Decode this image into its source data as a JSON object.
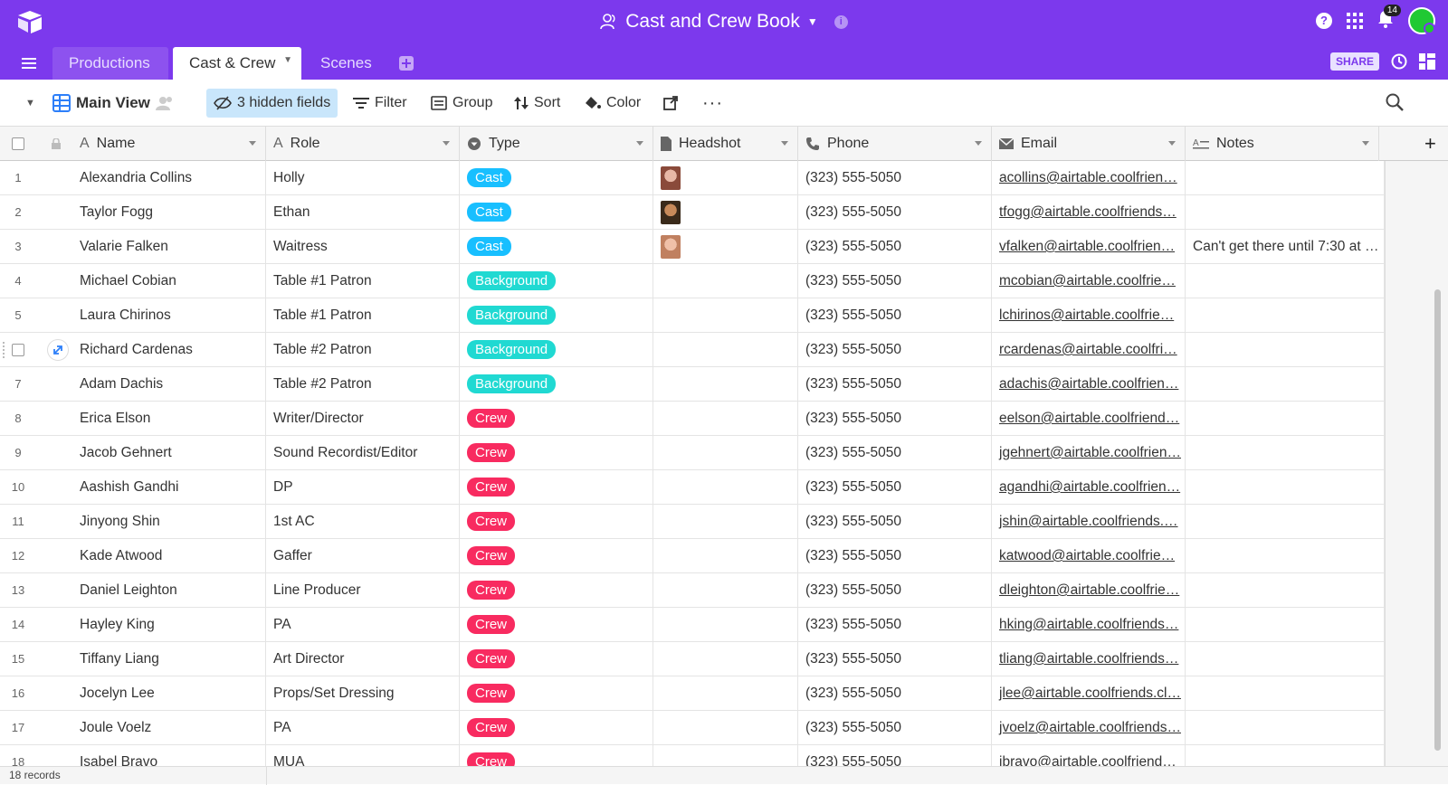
{
  "header": {
    "base_title": "Cast and Crew Book",
    "notification_count": "14",
    "share_label": "SHARE"
  },
  "tabs": [
    {
      "label": "Productions"
    },
    {
      "label": "Cast & Crew"
    },
    {
      "label": "Scenes"
    }
  ],
  "viewbar": {
    "view_name": "Main View",
    "hidden_fields": "3 hidden fields",
    "filter": "Filter",
    "group": "Group",
    "sort": "Sort",
    "color": "Color"
  },
  "columns": [
    "Name",
    "Role",
    "Type",
    "Headshot",
    "Phone",
    "Email",
    "Notes"
  ],
  "rows": [
    {
      "num": "1",
      "name": "Alexandria Collins",
      "role": "Holly",
      "type": "Cast",
      "headshot": true,
      "phone": "(323) 555-5050",
      "email": "acollins@airtable.coolfrien…",
      "notes": ""
    },
    {
      "num": "2",
      "name": "Taylor Fogg",
      "role": "Ethan",
      "type": "Cast",
      "headshot": true,
      "phone": "(323) 555-5050",
      "email": "tfogg@airtable.coolfriends…",
      "notes": ""
    },
    {
      "num": "3",
      "name": "Valarie Falken",
      "role": "Waitress",
      "type": "Cast",
      "headshot": true,
      "phone": "(323) 555-5050",
      "email": "vfalken@airtable.coolfrien…",
      "notes": "Can't get there until 7:30 at …"
    },
    {
      "num": "4",
      "name": "Michael Cobian",
      "role": "Table #1 Patron",
      "type": "Background",
      "headshot": false,
      "phone": "(323) 555-5050",
      "email": "mcobian@airtable.coolfrie…",
      "notes": ""
    },
    {
      "num": "5",
      "name": "Laura Chirinos",
      "role": "Table #1 Patron",
      "type": "Background",
      "headshot": false,
      "phone": "(323) 555-5050",
      "email": "lchirinos@airtable.coolfrie…",
      "notes": ""
    },
    {
      "num": "",
      "name": "Richard Cardenas",
      "role": "Table #2 Patron",
      "type": "Background",
      "headshot": false,
      "phone": "(323) 555-5050",
      "email": "rcardenas@airtable.coolfri…",
      "notes": ""
    },
    {
      "num": "7",
      "name": "Adam Dachis",
      "role": "Table #2 Patron",
      "type": "Background",
      "headshot": false,
      "phone": "(323) 555-5050",
      "email": "adachis@airtable.coolfrien…",
      "notes": ""
    },
    {
      "num": "8",
      "name": "Erica Elson",
      "role": "Writer/Director",
      "type": "Crew",
      "headshot": false,
      "phone": "(323) 555-5050",
      "email": "eelson@airtable.coolfriend…",
      "notes": ""
    },
    {
      "num": "9",
      "name": "Jacob Gehnert",
      "role": "Sound Recordist/Editor",
      "type": "Crew",
      "headshot": false,
      "phone": "(323) 555-5050",
      "email": "jgehnert@airtable.coolfrien…",
      "notes": ""
    },
    {
      "num": "10",
      "name": "Aashish Gandhi",
      "role": "DP",
      "type": "Crew",
      "headshot": false,
      "phone": "(323) 555-5050",
      "email": "agandhi@airtable.coolfrien…",
      "notes": ""
    },
    {
      "num": "11",
      "name": "Jinyong Shin",
      "role": "1st AC",
      "type": "Crew",
      "headshot": false,
      "phone": "(323) 555-5050",
      "email": "jshin@airtable.coolfriends.…",
      "notes": ""
    },
    {
      "num": "12",
      "name": "Kade Atwood",
      "role": "Gaffer",
      "type": "Crew",
      "headshot": false,
      "phone": "(323) 555-5050",
      "email": "katwood@airtable.coolfrie…",
      "notes": ""
    },
    {
      "num": "13",
      "name": "Daniel Leighton",
      "role": "Line Producer",
      "type": "Crew",
      "headshot": false,
      "phone": "(323) 555-5050",
      "email": "dleighton@airtable.coolfrie…",
      "notes": ""
    },
    {
      "num": "14",
      "name": "Hayley King",
      "role": "PA",
      "type": "Crew",
      "headshot": false,
      "phone": "(323) 555-5050",
      "email": "hking@airtable.coolfriends…",
      "notes": ""
    },
    {
      "num": "15",
      "name": "Tiffany Liang",
      "role": "Art Director",
      "type": "Crew",
      "headshot": false,
      "phone": "(323) 555-5050",
      "email": "tliang@airtable.coolfriends…",
      "notes": ""
    },
    {
      "num": "16",
      "name": "Jocelyn Lee",
      "role": "Props/Set Dressing",
      "type": "Crew",
      "headshot": false,
      "phone": "(323) 555-5050",
      "email": "jlee@airtable.coolfriends.cl…",
      "notes": ""
    },
    {
      "num": "17",
      "name": "Joule Voelz",
      "role": "PA",
      "type": "Crew",
      "headshot": false,
      "phone": "(323) 555-5050",
      "email": "jvoelz@airtable.coolfriends…",
      "notes": ""
    },
    {
      "num": "18",
      "name": "Isabel Bravo",
      "role": "MUA",
      "type": "Crew",
      "headshot": false,
      "phone": "(323) 555-5050",
      "email": "ibravo@airtable.coolfriend…",
      "notes": ""
    }
  ],
  "footer": {
    "record_count": "18 records"
  },
  "colors": {
    "brand": "#7c39ed",
    "cast": "#18bfff",
    "background": "#20d9d2",
    "crew": "#f82b60"
  }
}
